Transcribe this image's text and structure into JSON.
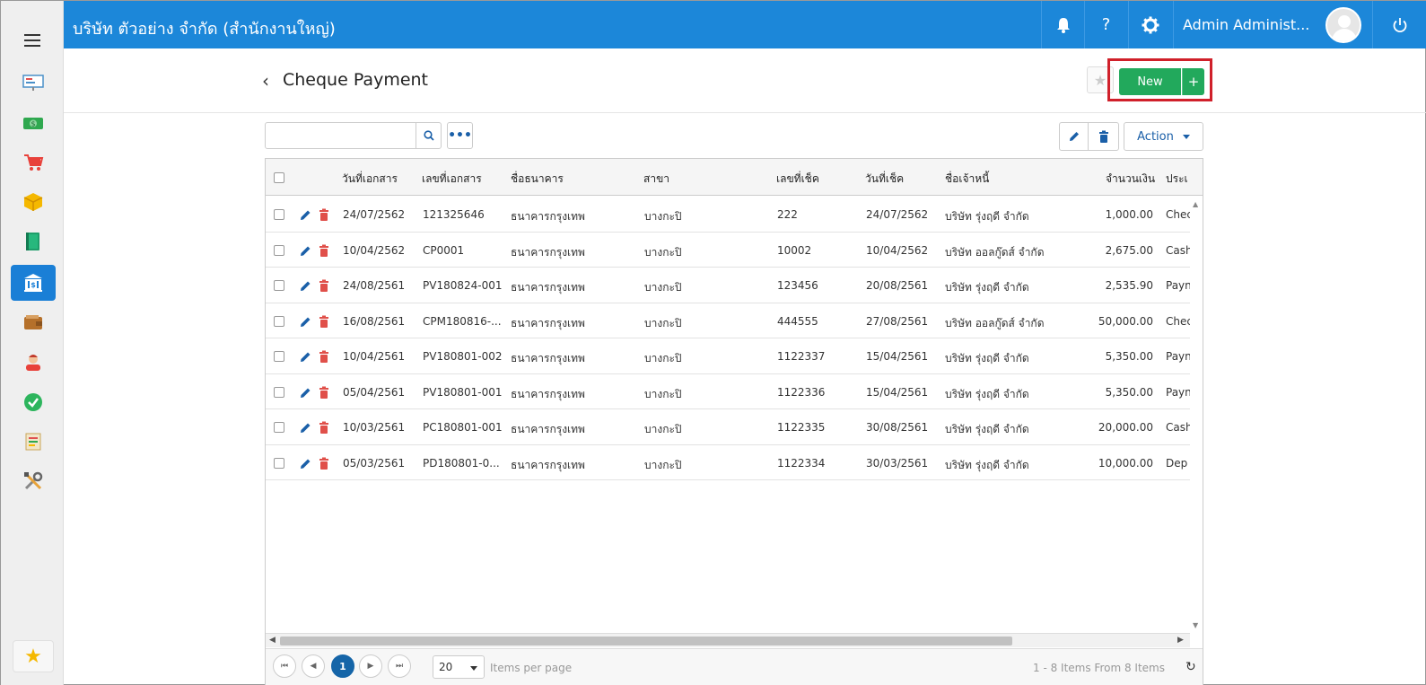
{
  "topbar": {
    "company": "บริษัท ตัวอย่าง จำกัด (สำนักงานใหญ่)",
    "user_name": "Admin Administ...",
    "help_label": "?"
  },
  "page": {
    "title": "Cheque Payment",
    "new_label": "New",
    "new_plus": "+",
    "action_label": "Action"
  },
  "search": {
    "placeholder": "",
    "value": ""
  },
  "table": {
    "headers": [
      "วันที่เอกสาร",
      "เลขที่เอกสาร",
      "ชื่อธนาคาร",
      "สาขา",
      "เลขที่เช็ค",
      "วันที่เช็ค",
      "ชื่อเจ้าหนี้",
      "จำนวนเงิน",
      "ประเ"
    ],
    "rows": [
      [
        "24/07/2562",
        "121325646",
        "ธนาคารกรุงเทพ",
        "บางกะปิ",
        "222",
        "24/07/2562",
        "บริษัท รุ่งฤดี จำกัด",
        "1,000.00",
        "Chec"
      ],
      [
        "10/04/2562",
        "CP0001",
        "ธนาคารกรุงเทพ",
        "บางกะปิ",
        "10002",
        "10/04/2562",
        "บริษัท ออลกู๊ดส์ จำกัด",
        "2,675.00",
        "Cash"
      ],
      [
        "24/08/2561",
        "PV180824-001",
        "ธนาคารกรุงเทพ",
        "บางกะปิ",
        "123456",
        "20/08/2561",
        "บริษัท รุ่งฤดี จำกัด",
        "2,535.90",
        "Payn"
      ],
      [
        "16/08/2561",
        "CPM180816-...",
        "ธนาคารกรุงเทพ",
        "บางกะปิ",
        "444555",
        "27/08/2561",
        "บริษัท ออลกู๊ดส์ จำกัด",
        "50,000.00",
        "Chec"
      ],
      [
        "10/04/2561",
        "PV180801-002",
        "ธนาคารกรุงเทพ",
        "บางกะปิ",
        "1122337",
        "15/04/2561",
        "บริษัท รุ่งฤดี จำกัด",
        "5,350.00",
        "Payn"
      ],
      [
        "05/04/2561",
        "PV180801-001",
        "ธนาคารกรุงเทพ",
        "บางกะปิ",
        "1122336",
        "15/04/2561",
        "บริษัท รุ่งฤดี จำกัด",
        "5,350.00",
        "Payn"
      ],
      [
        "10/03/2561",
        "PC180801-001",
        "ธนาคารกรุงเทพ",
        "บางกะปิ",
        "1122335",
        "30/08/2561",
        "บริษัท รุ่งฤดี จำกัด",
        "20,000.00",
        "Cash"
      ],
      [
        "05/03/2561",
        "PD180801-0...",
        "ธนาคารกรุงเทพ",
        "บางกะปิ",
        "1122334",
        "30/03/2561",
        "บริษัท รุ่งฤดี จำกัด",
        "10,000.00",
        "Dep"
      ]
    ]
  },
  "pager": {
    "current_page": "1",
    "page_size": "20",
    "items_per_page_label": "Items per page",
    "info": "1 - 8 Items From 8 Items"
  },
  "colors": {
    "topbar": "#1c87d9",
    "new_button": "#22a95c",
    "highlight_border": "#d0202a",
    "active_sidebar": "#1a7fd6",
    "delete_icon": "#e0504a",
    "edit_icon": "#1a5fa8"
  },
  "sidebar": {
    "items": [
      "presentation-icon",
      "money-icon",
      "cart-icon",
      "box-icon",
      "book-icon",
      "bank-icon",
      "wallet-icon",
      "person-icon",
      "check-icon",
      "report-icon",
      "tools-icon"
    ],
    "active_index": 5
  }
}
